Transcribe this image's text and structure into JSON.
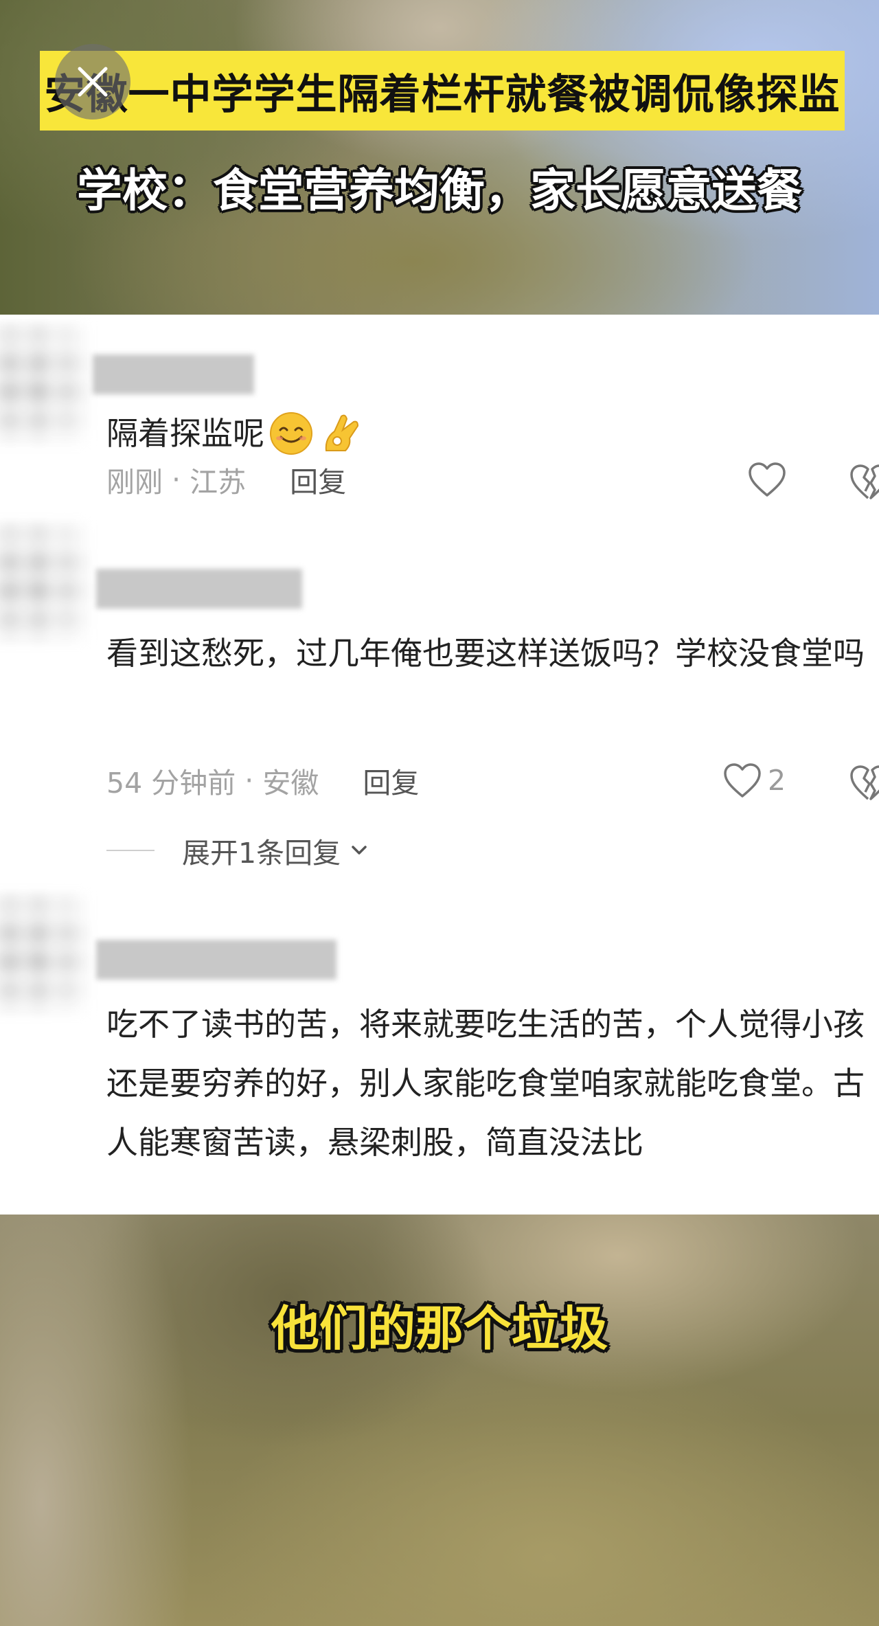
{
  "video": {
    "headline_line1": "安徽一中学学生隔着栏杆就餐被调侃像探监",
    "headline_line2": "学校：食堂营养均衡，家长愿意送餐",
    "subtitle": "他们的那个垃圾",
    "close_icon": "close-icon"
  },
  "comments": [
    {
      "text": "隔着探监呢",
      "emojis": [
        "smiling-face-emoji",
        "ok-hand-emoji"
      ],
      "time": "刚刚",
      "separator": " · ",
      "location": "江苏",
      "reply_label": "回复",
      "like_count": ""
    },
    {
      "text": "看到这愁死，过几年俺也要这样送饭吗？学校没食堂吗",
      "time": "54 分钟前",
      "separator": " · ",
      "location": "安徽",
      "reply_label": "回复",
      "like_count": "2",
      "expand_label": "展开1条回复"
    },
    {
      "text": "吃不了读书的苦，将来就要吃生活的苦，个人觉得小孩还是要穷养的好，别人家能吃食堂咱家就能吃食堂。古人能寒窗苦读，悬梁刺股，简直没法比"
    }
  ],
  "colors": {
    "headline_bg": "#f8e63a",
    "subtitle_text": "#f8e23a",
    "meta_text": "#a3a3a3",
    "body_text": "#222222"
  }
}
